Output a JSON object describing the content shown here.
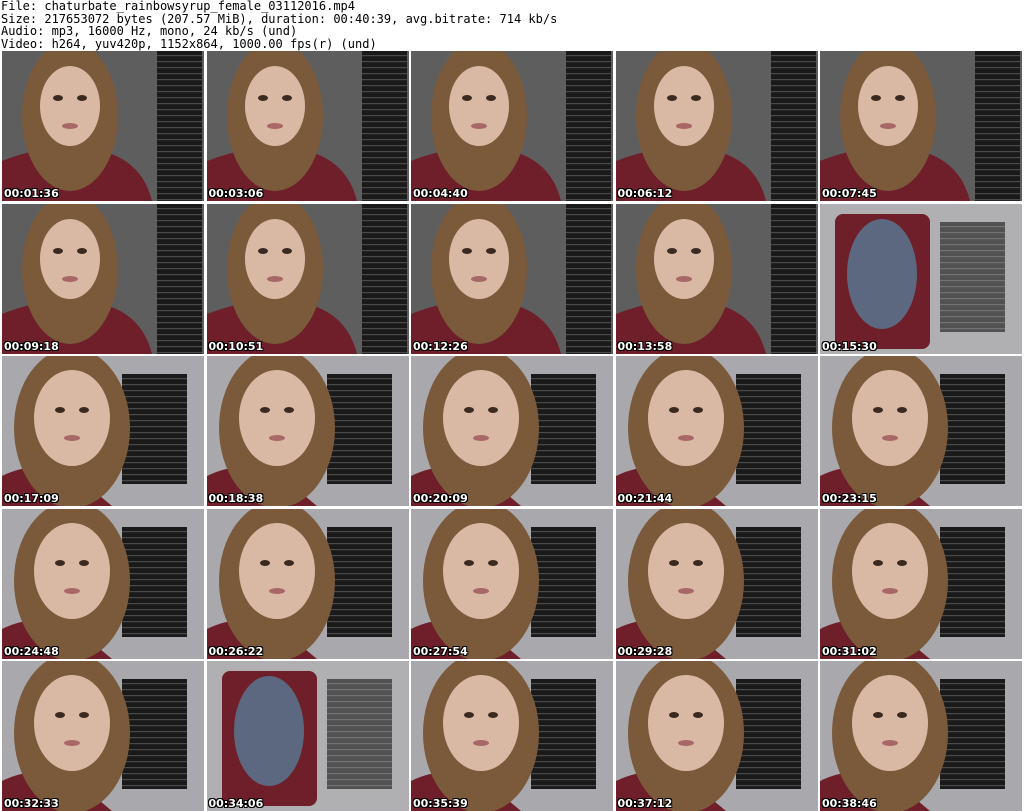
{
  "header": {
    "file_line": "File: chaturbate_rainbowsyrup_female_03112016.mp4",
    "size_line": "Size: 217653072 bytes (207.57 MiB), duration: 00:40:39, avg.bitrate: 714 kb/s",
    "audio_line": "Audio: mp3, 16000 Hz, mono, 24 kb/s (und)",
    "video_line": "Video: h264, yuv420p, 1152x864, 1000.00 fps(r) (und)"
  },
  "thumbnails": [
    {
      "timestamp": "00:01:36",
      "scene": "room-dark"
    },
    {
      "timestamp": "00:03:06",
      "scene": "room-dark"
    },
    {
      "timestamp": "00:04:40",
      "scene": "room-dark"
    },
    {
      "timestamp": "00:06:12",
      "scene": "room-dark"
    },
    {
      "timestamp": "00:07:45",
      "scene": "room-dark"
    },
    {
      "timestamp": "00:09:18",
      "scene": "room-dark"
    },
    {
      "timestamp": "00:10:51",
      "scene": "room-dark"
    },
    {
      "timestamp": "00:12:26",
      "scene": "room-dark"
    },
    {
      "timestamp": "00:13:58",
      "scene": "room-dark"
    },
    {
      "timestamp": "00:15:30",
      "scene": "room-standing"
    },
    {
      "timestamp": "00:17:09",
      "scene": "closeup-light"
    },
    {
      "timestamp": "00:18:38",
      "scene": "closeup-light"
    },
    {
      "timestamp": "00:20:09",
      "scene": "closeup-light"
    },
    {
      "timestamp": "00:21:44",
      "scene": "closeup-light"
    },
    {
      "timestamp": "00:23:15",
      "scene": "closeup-light"
    },
    {
      "timestamp": "00:24:48",
      "scene": "closeup-light"
    },
    {
      "timestamp": "00:26:22",
      "scene": "closeup-light"
    },
    {
      "timestamp": "00:27:54",
      "scene": "closeup-light"
    },
    {
      "timestamp": "00:29:28",
      "scene": "closeup-light"
    },
    {
      "timestamp": "00:31:02",
      "scene": "closeup-light"
    },
    {
      "timestamp": "00:32:33",
      "scene": "closeup-light"
    },
    {
      "timestamp": "00:34:06",
      "scene": "room-standing"
    },
    {
      "timestamp": "00:35:39",
      "scene": "closeup-light"
    },
    {
      "timestamp": "00:37:12",
      "scene": "closeup-light"
    },
    {
      "timestamp": "00:38:46",
      "scene": "closeup-light"
    }
  ],
  "colors": {
    "wall_dark": "#5e5e5e",
    "wall_light": "#a9a9ad",
    "blinds": "#1a1a1a",
    "hair": "#7a5a3a",
    "skin": "#d9b9a4",
    "shirt": "#6e1f2a"
  }
}
